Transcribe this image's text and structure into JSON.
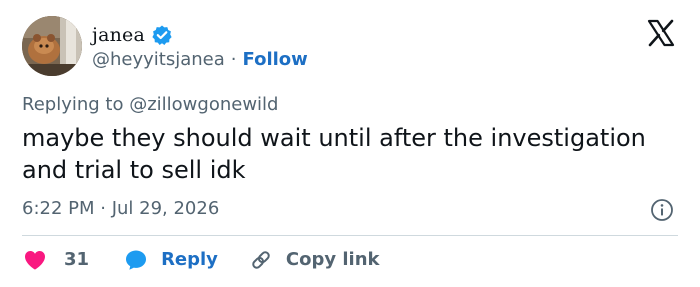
{
  "user": {
    "display_name": "janea",
    "handle": "@heyyitsjanea",
    "separator": "·",
    "follow_label": "Follow"
  },
  "reply_context": {
    "prefix": "Replying to",
    "target": "@zillowgonewild"
  },
  "tweet": {
    "text": "maybe they should wait until after the investigation and trial to sell idk",
    "timestamp": "6:22 PM · Jul 29, 2026"
  },
  "actions": {
    "like_count": "31",
    "reply_label": "Reply",
    "copy_link_label": "Copy link"
  },
  "icons": {
    "verified": "verified-badge-icon",
    "logo": "x-logo-icon",
    "info": "info-icon",
    "like": "heart-icon",
    "reply": "speech-bubble-icon",
    "copy": "link-icon"
  },
  "colors": {
    "accent_blue": "#1d6fc4",
    "like_pink": "#f91880",
    "secondary_text": "#536471",
    "primary_text": "#0f1419",
    "divider": "#cfd9de"
  }
}
